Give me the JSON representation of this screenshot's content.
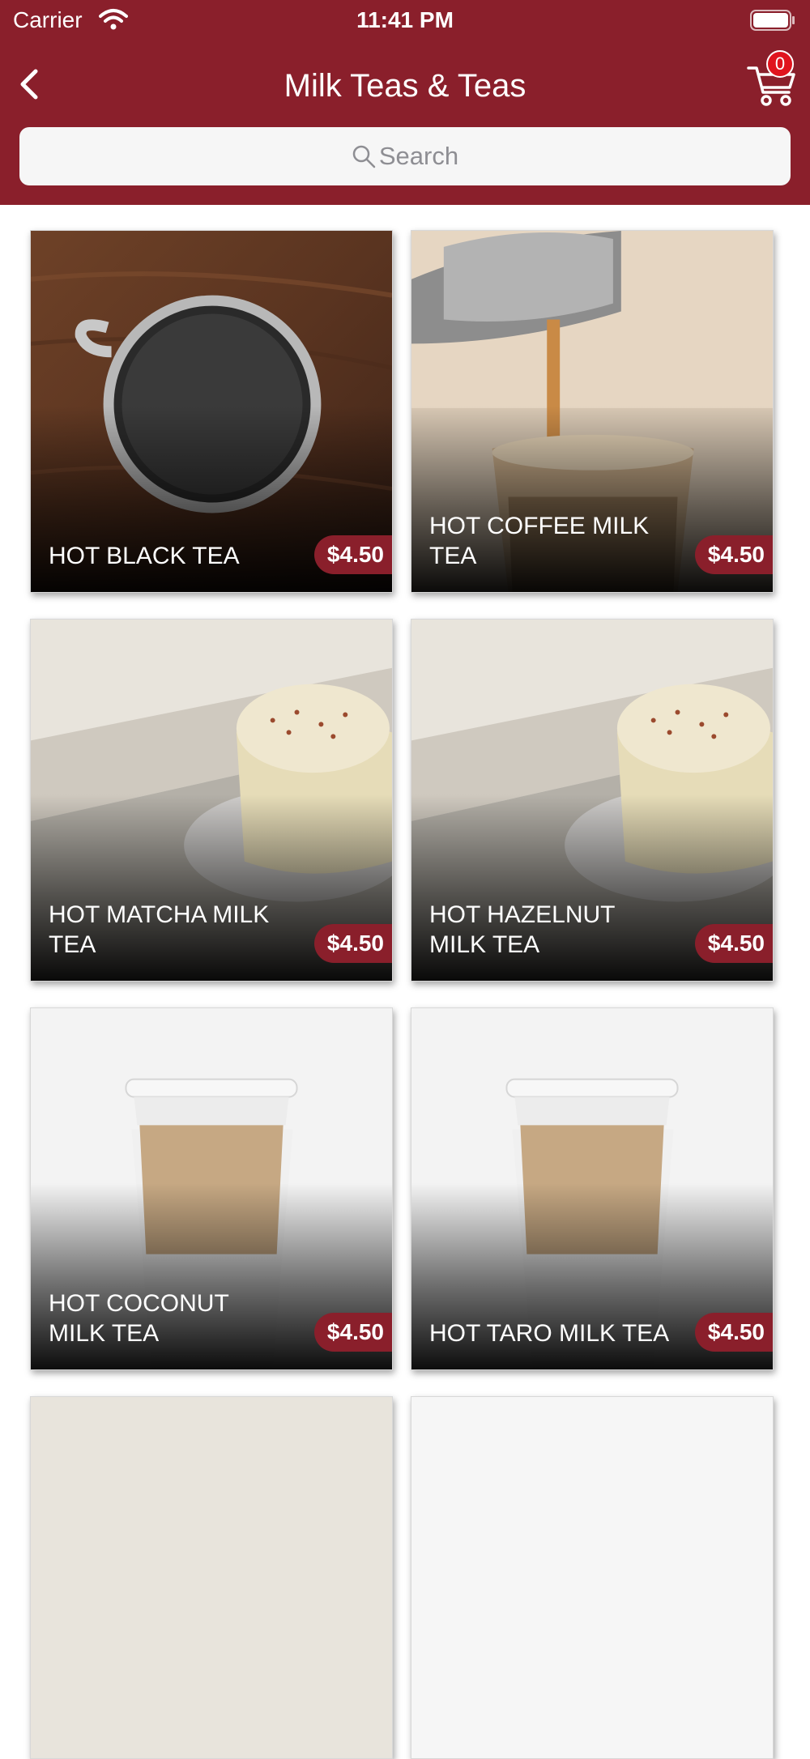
{
  "status_bar": {
    "carrier": "Carrier",
    "time": "11:41 PM"
  },
  "header": {
    "title": "Milk Teas & Teas",
    "cart_count": "0"
  },
  "search": {
    "placeholder": "Search"
  },
  "products": [
    {
      "name": "HOT BLACK TEA",
      "price": "$4.50"
    },
    {
      "name": "HOT COFFEE MILK TEA",
      "price": "$4.50"
    },
    {
      "name": "HOT MATCHA MILK TEA",
      "price": "$4.50"
    },
    {
      "name": "HOT HAZELNUT MILK TEA",
      "price": "$4.50"
    },
    {
      "name": "HOT COCONUT MILK TEA",
      "price": "$4.50"
    },
    {
      "name": "HOT TARO MILK TEA",
      "price": "$4.50"
    }
  ],
  "colors": {
    "brand": "#8a1f2b",
    "badge": "#e0141e"
  }
}
